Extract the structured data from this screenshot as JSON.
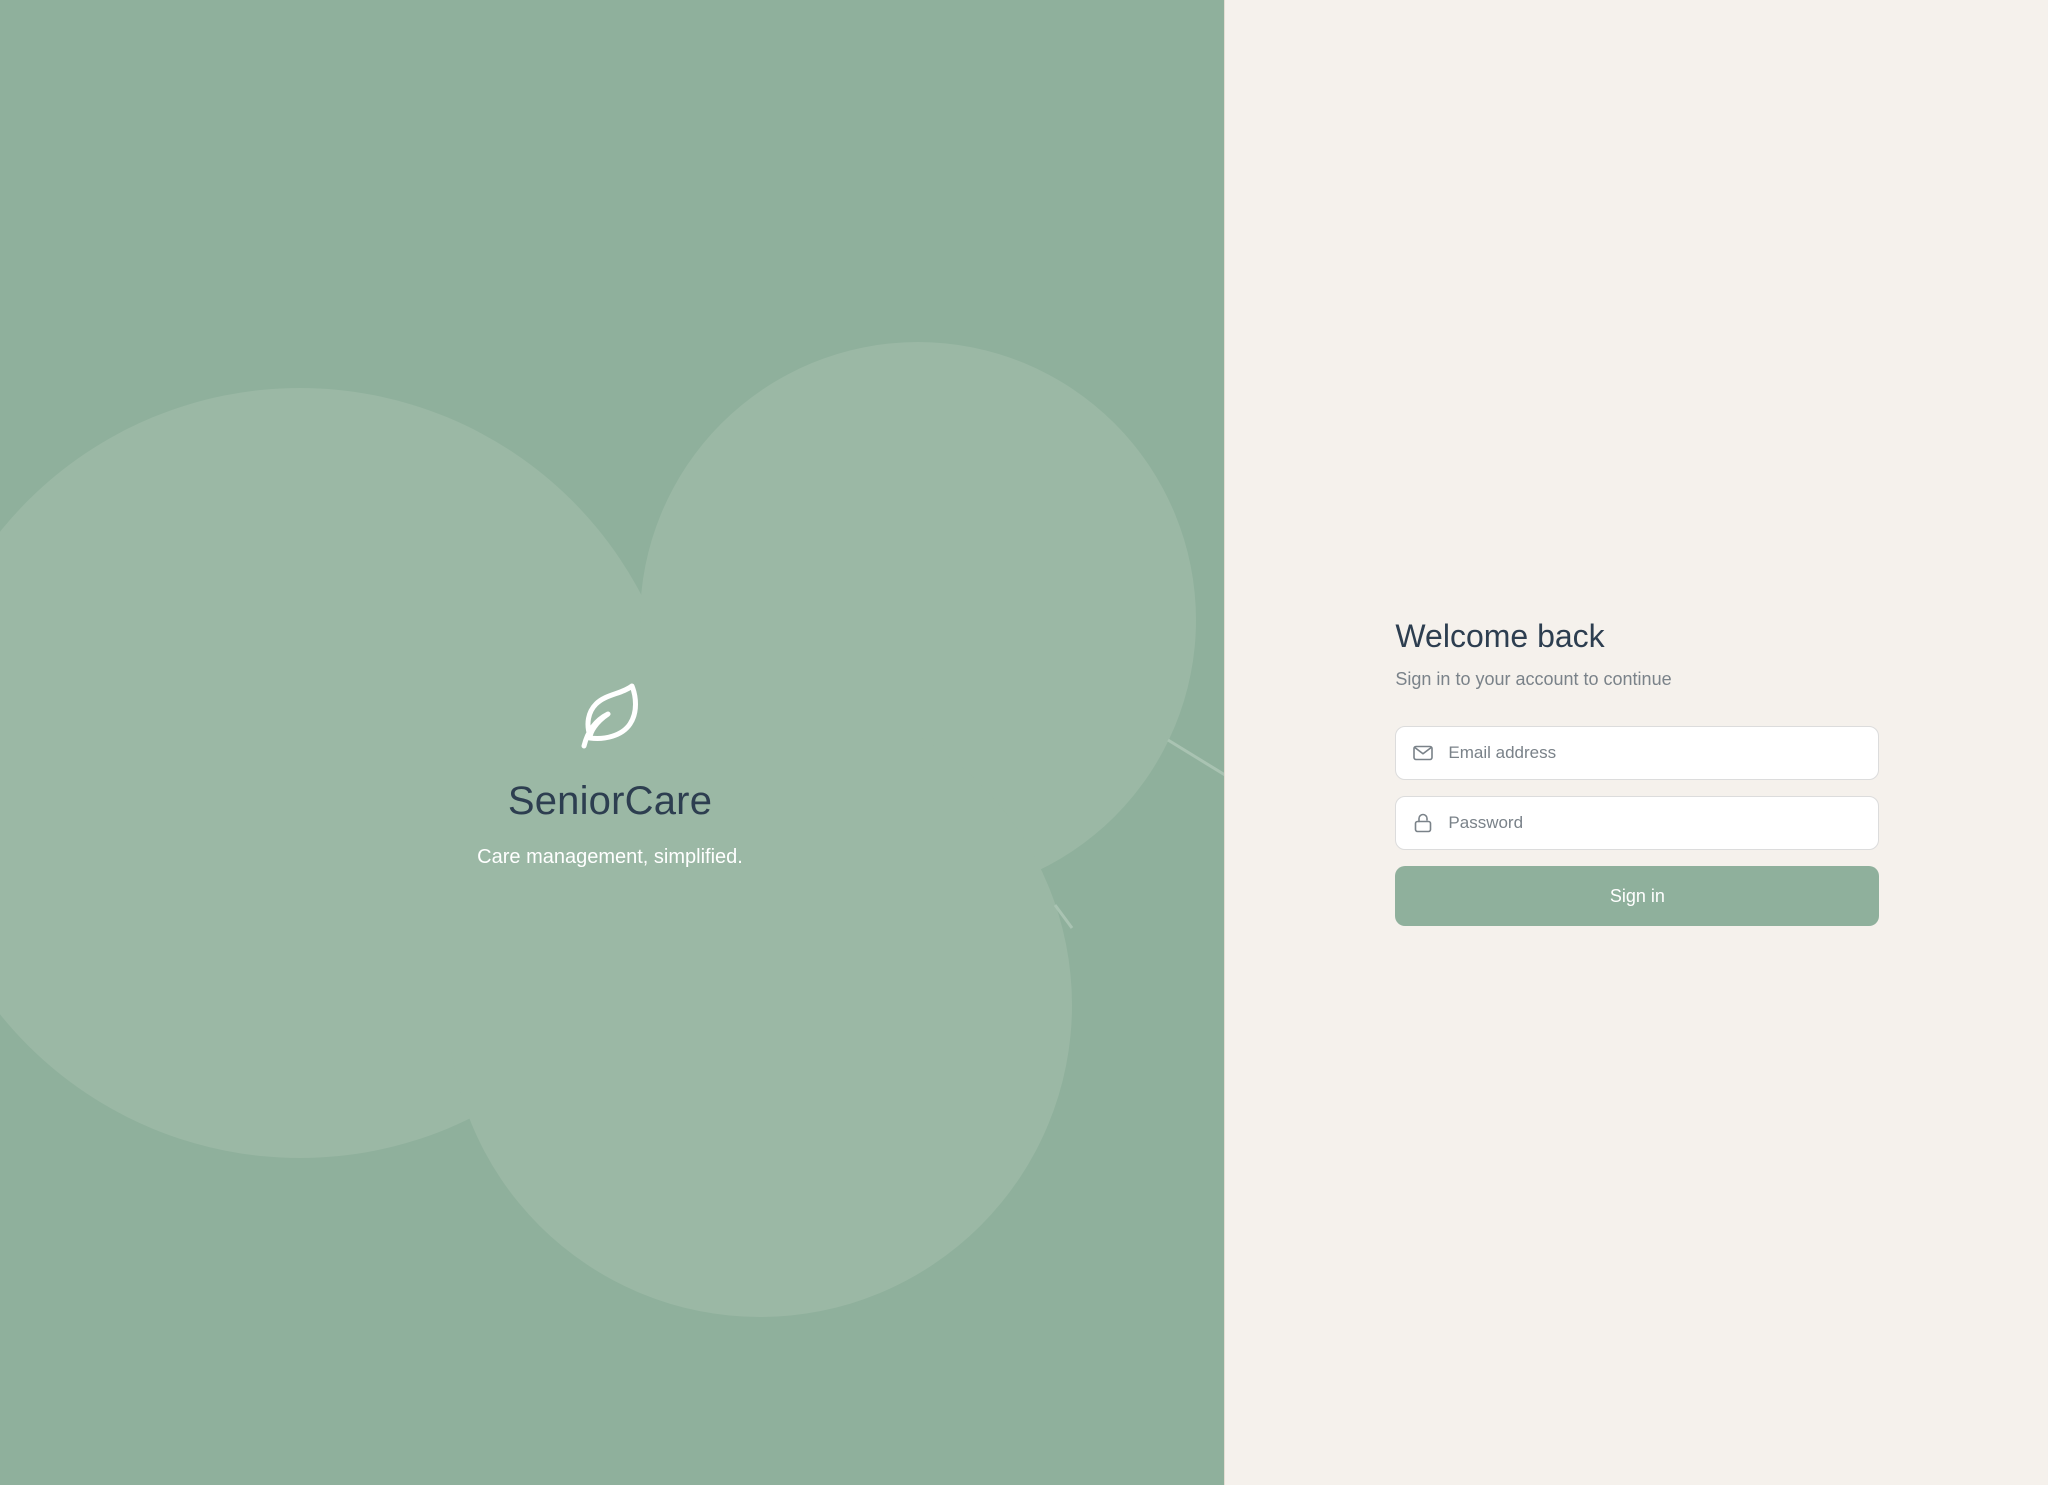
{
  "brand": {
    "logo_icon": "leaf-icon",
    "name": "SeniorCare",
    "tagline": "Care management, simplified."
  },
  "login": {
    "title": "Welcome back",
    "subtitle": "Sign in to your account to continue",
    "email": {
      "icon": "mail-icon",
      "placeholder": "Email address",
      "value": ""
    },
    "password": {
      "icon": "lock-icon",
      "placeholder": "Password",
      "value": ""
    },
    "submit_label": "Sign in"
  },
  "colors": {
    "hero_background": "#8fb09c",
    "hero_blob": "#9bb8a5",
    "panel_background": "#f5f1ec",
    "heading_text": "#2d3e50",
    "muted_text": "#7a8289",
    "button_background": "#8fb09c"
  }
}
